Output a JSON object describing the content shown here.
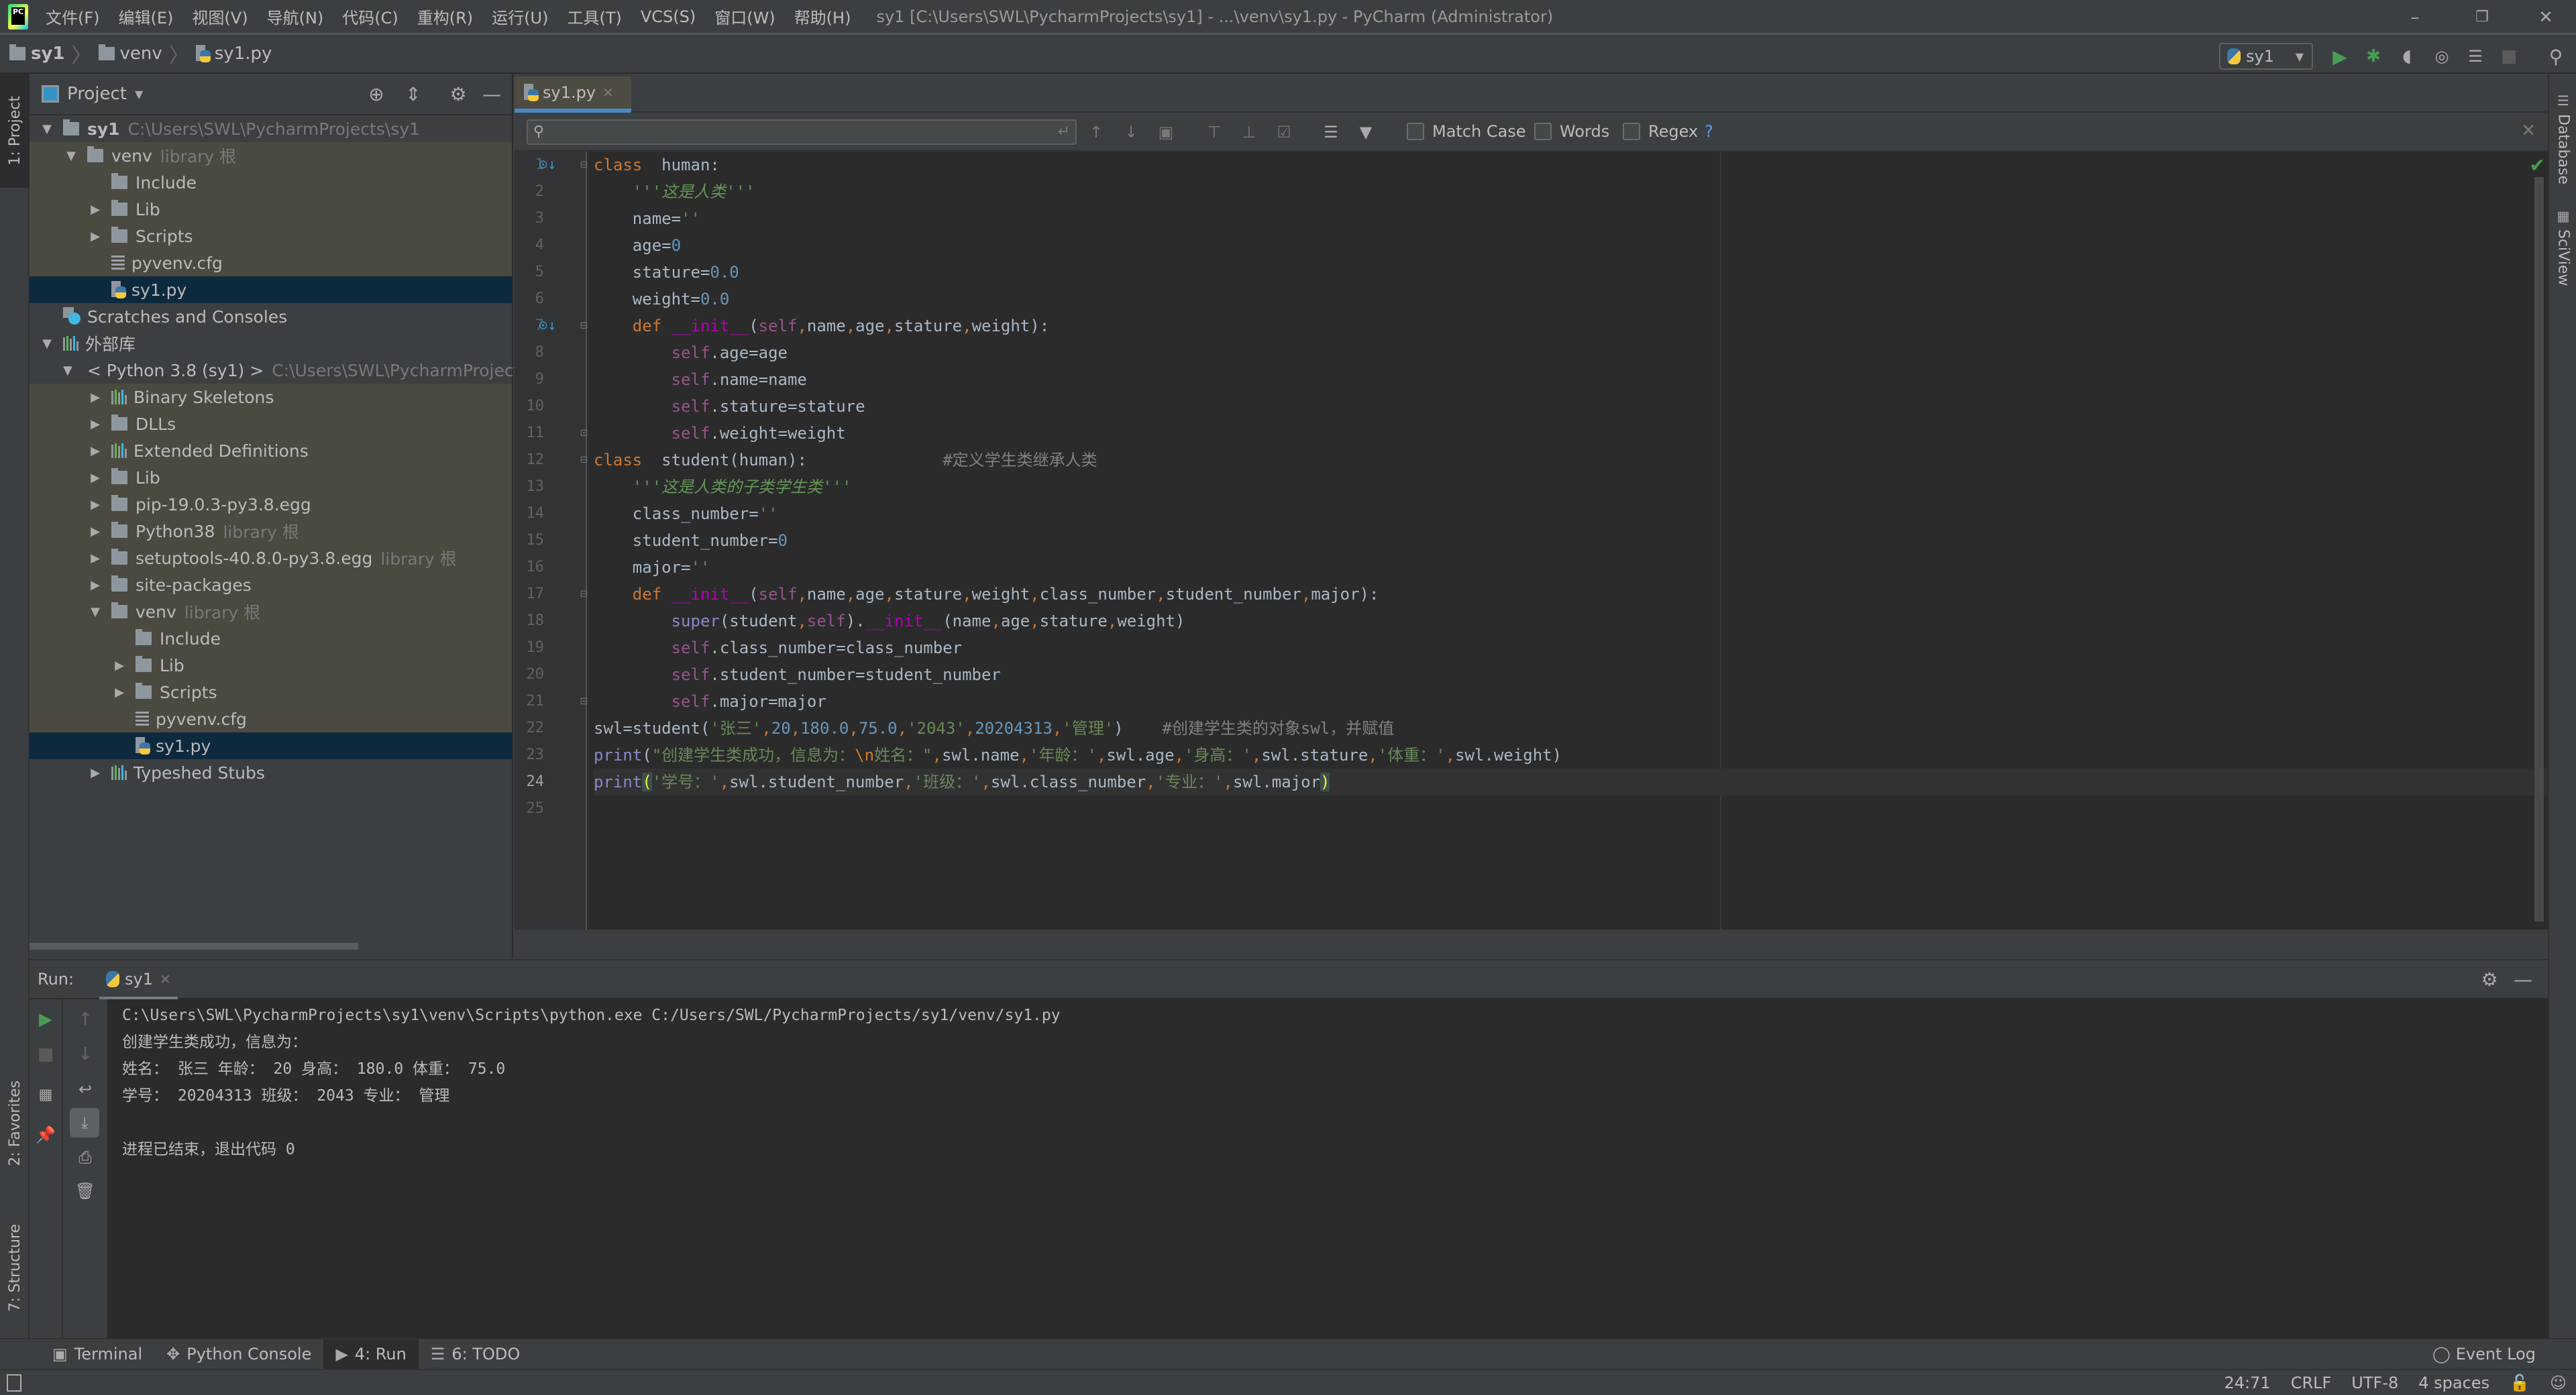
{
  "titlebar": {
    "menu": [
      "文件(F)",
      "编辑(E)",
      "视图(V)",
      "导航(N)",
      "代码(C)",
      "重构(R)",
      "运行(U)",
      "工具(T)",
      "VCS(S)",
      "窗口(W)",
      "帮助(H)"
    ],
    "window_title": "sy1 [C:\\Users\\SWL\\PycharmProjects\\sy1] - ...\\venv\\sy1.py - PyCharm (Administrator)",
    "minimize": "–",
    "restore": "❐",
    "close": "✕"
  },
  "breadcrumb": [
    "sy1",
    "venv",
    "sy1.py"
  ],
  "toolbar": {
    "run_config": "sy1"
  },
  "left_stripe": {
    "project": "1: Project",
    "favorites": "2: Favorites",
    "structure": "7: Structure"
  },
  "right_stripe": {
    "database": "Database",
    "sciview": "SciView"
  },
  "project_panel": {
    "title": "Project",
    "tree": [
      {
        "label": "sy1",
        "hint": "C:\\Users\\SWL\\PycharmProjects\\sy1",
        "bold": true,
        "depth": 0,
        "expand": "open",
        "icon": "folder",
        "style": ""
      },
      {
        "label": "venv",
        "hint": "library 根",
        "depth": 1,
        "expand": "open",
        "icon": "folder",
        "style": "lib"
      },
      {
        "label": "Include",
        "hint": "",
        "depth": 2,
        "expand": "none",
        "icon": "folder",
        "style": "lib"
      },
      {
        "label": "Lib",
        "hint": "",
        "depth": 2,
        "expand": "closed",
        "icon": "folder",
        "style": "lib"
      },
      {
        "label": "Scripts",
        "hint": "",
        "depth": 2,
        "expand": "closed",
        "icon": "folder",
        "style": "lib"
      },
      {
        "label": "pyvenv.cfg",
        "hint": "",
        "depth": 2,
        "expand": "none",
        "icon": "cfg",
        "style": "lib"
      },
      {
        "label": "sy1.py",
        "hint": "",
        "depth": 2,
        "expand": "none",
        "icon": "py",
        "style": "sel"
      },
      {
        "label": "Scratches and Consoles",
        "hint": "",
        "depth": 0,
        "expand": "none",
        "icon": "scratch",
        "style": ""
      },
      {
        "label": "外部库",
        "hint": "",
        "depth": 0,
        "expand": "open",
        "icon": "libs",
        "style": ""
      },
      {
        "label": "< Python 3.8 (sy1) >",
        "hint": "C:\\Users\\SWL\\PycharmProjects\\",
        "depth": 1,
        "expand": "open",
        "icon": "python",
        "style": ""
      },
      {
        "label": "Binary Skeletons",
        "hint": "",
        "depth": 2,
        "expand": "closed",
        "icon": "libs",
        "style": "lib"
      },
      {
        "label": "DLLs",
        "hint": "",
        "depth": 2,
        "expand": "closed",
        "icon": "folder",
        "style": "lib"
      },
      {
        "label": "Extended Definitions",
        "hint": "",
        "depth": 2,
        "expand": "closed",
        "icon": "libs",
        "style": "lib"
      },
      {
        "label": "Lib",
        "hint": "",
        "depth": 2,
        "expand": "closed",
        "icon": "folder",
        "style": "lib"
      },
      {
        "label": "pip-19.0.3-py3.8.egg",
        "hint": "",
        "depth": 2,
        "expand": "closed",
        "icon": "folder",
        "style": "lib"
      },
      {
        "label": "Python38",
        "hint": "library 根",
        "depth": 2,
        "expand": "closed",
        "icon": "folder",
        "style": "lib"
      },
      {
        "label": "setuptools-40.8.0-py3.8.egg",
        "hint": "library 根",
        "depth": 2,
        "expand": "closed",
        "icon": "folder",
        "style": "lib"
      },
      {
        "label": "site-packages",
        "hint": "",
        "depth": 2,
        "expand": "closed",
        "icon": "folder",
        "style": "lib"
      },
      {
        "label": "venv",
        "hint": "library 根",
        "depth": 2,
        "expand": "open",
        "icon": "folder",
        "style": "lib"
      },
      {
        "label": "Include",
        "hint": "",
        "depth": 3,
        "expand": "none",
        "icon": "folder",
        "style": "lib"
      },
      {
        "label": "Lib",
        "hint": "",
        "depth": 3,
        "expand": "closed",
        "icon": "folder",
        "style": "lib"
      },
      {
        "label": "Scripts",
        "hint": "",
        "depth": 3,
        "expand": "closed",
        "icon": "folder",
        "style": "lib"
      },
      {
        "label": "pyvenv.cfg",
        "hint": "",
        "depth": 3,
        "expand": "none",
        "icon": "cfg",
        "style": "lib"
      },
      {
        "label": "sy1.py",
        "hint": "",
        "depth": 3,
        "expand": "none",
        "icon": "py",
        "style": "sel"
      },
      {
        "label": "Typeshed Stubs",
        "hint": "",
        "depth": 2,
        "expand": "closed",
        "icon": "libs",
        "style": ""
      }
    ]
  },
  "editor": {
    "tab_label": "sy1.py",
    "search": {
      "value": "",
      "placeholder": "",
      "match_case": "Match Case",
      "words": "Words",
      "regex": "Regex",
      "help": "?"
    },
    "current_line": 24,
    "lines": [
      [
        [
          "kw",
          "class"
        ],
        [
          "",
          "  human:"
        ]
      ],
      [
        [
          "",
          "    "
        ],
        [
          "doc",
          "'''这是人类'''"
        ]
      ],
      [
        [
          "",
          "    name="
        ],
        [
          "str",
          "''"
        ]
      ],
      [
        [
          "",
          "    age="
        ],
        [
          "num",
          "0"
        ]
      ],
      [
        [
          "",
          "    stature="
        ],
        [
          "num",
          "0.0"
        ]
      ],
      [
        [
          "",
          "    weight="
        ],
        [
          "num",
          "0.0"
        ]
      ],
      [
        [
          "",
          "    "
        ],
        [
          "kw",
          "def "
        ],
        [
          "magic",
          "__init__"
        ],
        [
          "",
          "("
        ],
        [
          "self",
          "self"
        ],
        [
          "kw",
          ","
        ],
        [
          "",
          "name"
        ],
        [
          "kw",
          ","
        ],
        [
          "",
          "age"
        ],
        [
          "kw",
          ","
        ],
        [
          "",
          "stature"
        ],
        [
          "kw",
          ","
        ],
        [
          "",
          "weight):"
        ]
      ],
      [
        [
          "",
          "        "
        ],
        [
          "self",
          "self"
        ],
        [
          "",
          ".age=age"
        ]
      ],
      [
        [
          "",
          "        "
        ],
        [
          "self",
          "self"
        ],
        [
          "",
          ".name=name"
        ]
      ],
      [
        [
          "",
          "        "
        ],
        [
          "self",
          "self"
        ],
        [
          "",
          ".stature=stature"
        ]
      ],
      [
        [
          "",
          "        "
        ],
        [
          "self",
          "self"
        ],
        [
          "",
          ".weight=weight"
        ]
      ],
      [
        [
          "kw",
          "class"
        ],
        [
          "",
          ""
        ],
        [
          "",
          "  student(human):              "
        ],
        [
          "cmt",
          "#定义学生类继承人类"
        ]
      ],
      [
        [
          "",
          "    "
        ],
        [
          "doc",
          "'''这是人类的子类学生类'''"
        ]
      ],
      [
        [
          "",
          "    class_number="
        ],
        [
          "str",
          "''"
        ]
      ],
      [
        [
          "",
          "    student_number="
        ],
        [
          "num",
          "0"
        ]
      ],
      [
        [
          "",
          "    major="
        ],
        [
          "str",
          "''"
        ]
      ],
      [
        [
          "",
          "    "
        ],
        [
          "kw",
          "def "
        ],
        [
          "magic",
          "__init__"
        ],
        [
          "",
          "("
        ],
        [
          "self",
          "self"
        ],
        [
          "kw",
          ","
        ],
        [
          "",
          "name"
        ],
        [
          "kw",
          ","
        ],
        [
          "",
          "age"
        ],
        [
          "kw",
          ","
        ],
        [
          "",
          "stature"
        ],
        [
          "kw",
          ","
        ],
        [
          "",
          "weight"
        ],
        [
          "kw",
          ","
        ],
        [
          "",
          "class_number"
        ],
        [
          "kw",
          ","
        ],
        [
          "",
          "student_number"
        ],
        [
          "kw",
          ","
        ],
        [
          "",
          "major):"
        ]
      ],
      [
        [
          "",
          "        "
        ],
        [
          "bi",
          "super"
        ],
        [
          "",
          "(student"
        ],
        [
          "kw",
          ","
        ],
        [
          "self",
          "self"
        ],
        [
          "",
          ")."
        ],
        [
          "magic",
          "__init__"
        ],
        [
          "",
          "(name"
        ],
        [
          "kw",
          ","
        ],
        [
          "",
          "age"
        ],
        [
          "kw",
          ","
        ],
        [
          "",
          "stature"
        ],
        [
          "kw",
          ","
        ],
        [
          "",
          "weight)"
        ]
      ],
      [
        [
          "",
          "        "
        ],
        [
          "self",
          "self"
        ],
        [
          "",
          ".class_number=class_number"
        ]
      ],
      [
        [
          "",
          "        "
        ],
        [
          "self",
          "self"
        ],
        [
          "",
          ".student_number=student_number"
        ]
      ],
      [
        [
          "",
          "        "
        ],
        [
          "self",
          "self"
        ],
        [
          "",
          ".major=major"
        ]
      ],
      [
        [
          "",
          "swl=student("
        ],
        [
          "str",
          "'张三'"
        ],
        [
          "kw",
          ","
        ],
        [
          "num",
          "20"
        ],
        [
          "kw",
          ","
        ],
        [
          "num",
          "180.0"
        ],
        [
          "kw",
          ","
        ],
        [
          "num",
          "75.0"
        ],
        [
          "kw",
          ","
        ],
        [
          "str",
          "'2043'"
        ],
        [
          "kw",
          ","
        ],
        [
          "num",
          "20204313"
        ],
        [
          "kw",
          ","
        ],
        [
          "str",
          "'管理'"
        ],
        [
          "",
          ")    "
        ],
        [
          "cmt",
          "#创建学生类的对象swl，并赋值"
        ]
      ],
      [
        [
          "bi",
          "print"
        ],
        [
          "",
          "("
        ],
        [
          "str",
          "\"创建学生类成功，信息为："
        ],
        [
          "esc",
          "\\n"
        ],
        [
          "str",
          "姓名：\""
        ],
        [
          "kw",
          ","
        ],
        [
          "",
          "swl.name"
        ],
        [
          "kw",
          ","
        ],
        [
          "str",
          "'年龄：'"
        ],
        [
          "kw",
          ","
        ],
        [
          "",
          "swl.age"
        ],
        [
          "kw",
          ","
        ],
        [
          "str",
          "'身高：'"
        ],
        [
          "kw",
          ","
        ],
        [
          "",
          "swl.stature"
        ],
        [
          "kw",
          ","
        ],
        [
          "str",
          "'体重：'"
        ],
        [
          "kw",
          ","
        ],
        [
          "",
          "swl.weight)"
        ]
      ],
      [
        [
          "bi",
          "print"
        ],
        [
          "brace",
          "("
        ],
        [
          "str",
          "'学号：'"
        ],
        [
          "kw",
          ","
        ],
        [
          "",
          "swl.student_number"
        ],
        [
          "kw",
          ","
        ],
        [
          "str",
          "'班级：'"
        ],
        [
          "kw",
          ","
        ],
        [
          "",
          "swl.class_number"
        ],
        [
          "kw",
          ","
        ],
        [
          "str",
          "'专业：'"
        ],
        [
          "kw",
          ","
        ],
        [
          "",
          "swl.major"
        ],
        [
          "brace",
          ")"
        ]
      ],
      [
        [
          "",
          ""
        ]
      ]
    ]
  },
  "run_panel": {
    "label": "Run:",
    "tab": "sy1",
    "output": [
      "C:\\Users\\SWL\\PycharmProjects\\sy1\\venv\\Scripts\\python.exe C:/Users/SWL/PycharmProjects/sy1/venv/sy1.py",
      "创建学生类成功，信息为：",
      "姓名： 张三 年龄： 20 身高： 180.0 体重： 75.0",
      "学号： 20204313 班级： 2043 专业： 管理",
      "",
      "进程已结束，退出代码 0"
    ]
  },
  "bottom_tabs": {
    "terminal": "Terminal",
    "python_console": "Python Console",
    "run": "4: Run",
    "todo": "6: TODO",
    "event_log": "Event Log"
  },
  "status_bar": {
    "position": "24:71",
    "line_sep": "CRLF",
    "encoding": "UTF-8",
    "indent": "4 spaces"
  }
}
